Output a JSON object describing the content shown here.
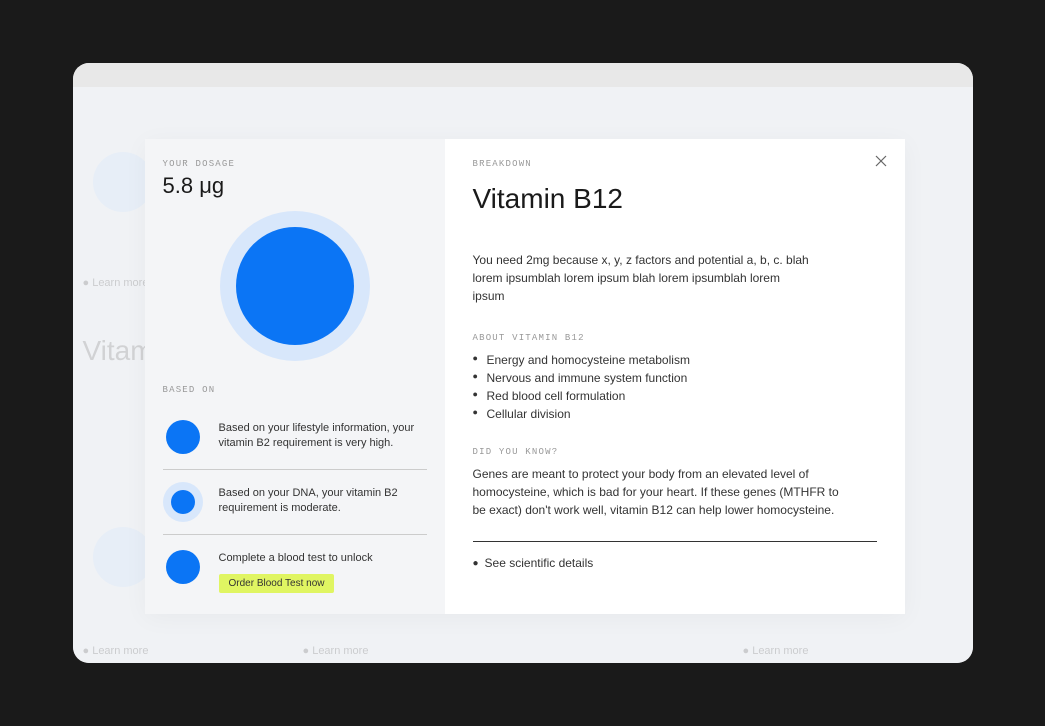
{
  "background": {
    "title": "Vitam"
  },
  "dosage": {
    "label": "YOUR DOSAGE",
    "value": "5.8 μg"
  },
  "based_on": {
    "label": "BASED ON",
    "items": [
      {
        "text": "Based on your lifestyle information, your vitamin B2 requirement is very high.",
        "style": "full"
      },
      {
        "text": "Based on your DNA, your vitamin B2 requirement is moderate.",
        "style": "ring"
      },
      {
        "text": "Complete a blood test to unlock",
        "style": "full",
        "cta": "Order Blood Test now"
      }
    ]
  },
  "breakdown": {
    "label": "BREAKDOWN",
    "title": "Vitamin B12",
    "intro": "You need 2mg because x, y, z factors and potential a, b, c.  blah lorem ipsumblah lorem ipsum blah lorem ipsumblah lorem ipsum",
    "about": {
      "label": "ABOUT VITAMIN B12",
      "items": [
        "Energy and homocysteine metabolism",
        "Nervous and immune system function",
        "Red blood cell formulation",
        "Cellular division"
      ]
    },
    "did_you_know": {
      "label": "DID YOU KNOW?",
      "text": "Genes are meant to protect your body from an elevated level of homocysteine, which is bad for your heart. If these genes (MTHFR to be exact) don't work well, vitamin B12 can help lower homocysteine."
    },
    "scientific_link": "See scientific details"
  }
}
